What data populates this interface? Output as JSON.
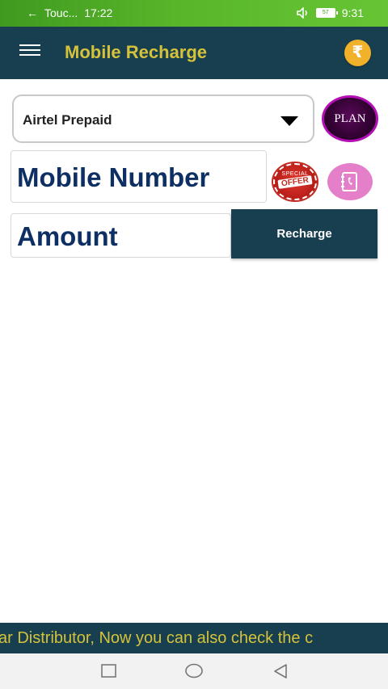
{
  "status_bar": {
    "back_arrow": "←",
    "app_label": "Touc...",
    "left_time": "17:22",
    "right_time": "9:31",
    "battery_level": "57",
    "volume_icon": "speaker-icon"
  },
  "app_bar": {
    "title": "Mobile Recharge",
    "wallet_symbol": "₹",
    "menu_icon": "hamburger-icon"
  },
  "form": {
    "operator": "Airtel Prepaid",
    "plan_label": "PLAN",
    "mobile_placeholder": "Mobile Number",
    "offer_top": "SPECIAL",
    "offer_main": "OFFER",
    "amount_placeholder": "Amount",
    "recharge_label": "Recharge"
  },
  "marquee": {
    "text": "ar Distributor, Now you can also check the c"
  },
  "colors": {
    "primary": "#173f4f",
    "accent": "#d6c23a",
    "status_green": "#58b52a",
    "field_text": "#0d2f63"
  }
}
